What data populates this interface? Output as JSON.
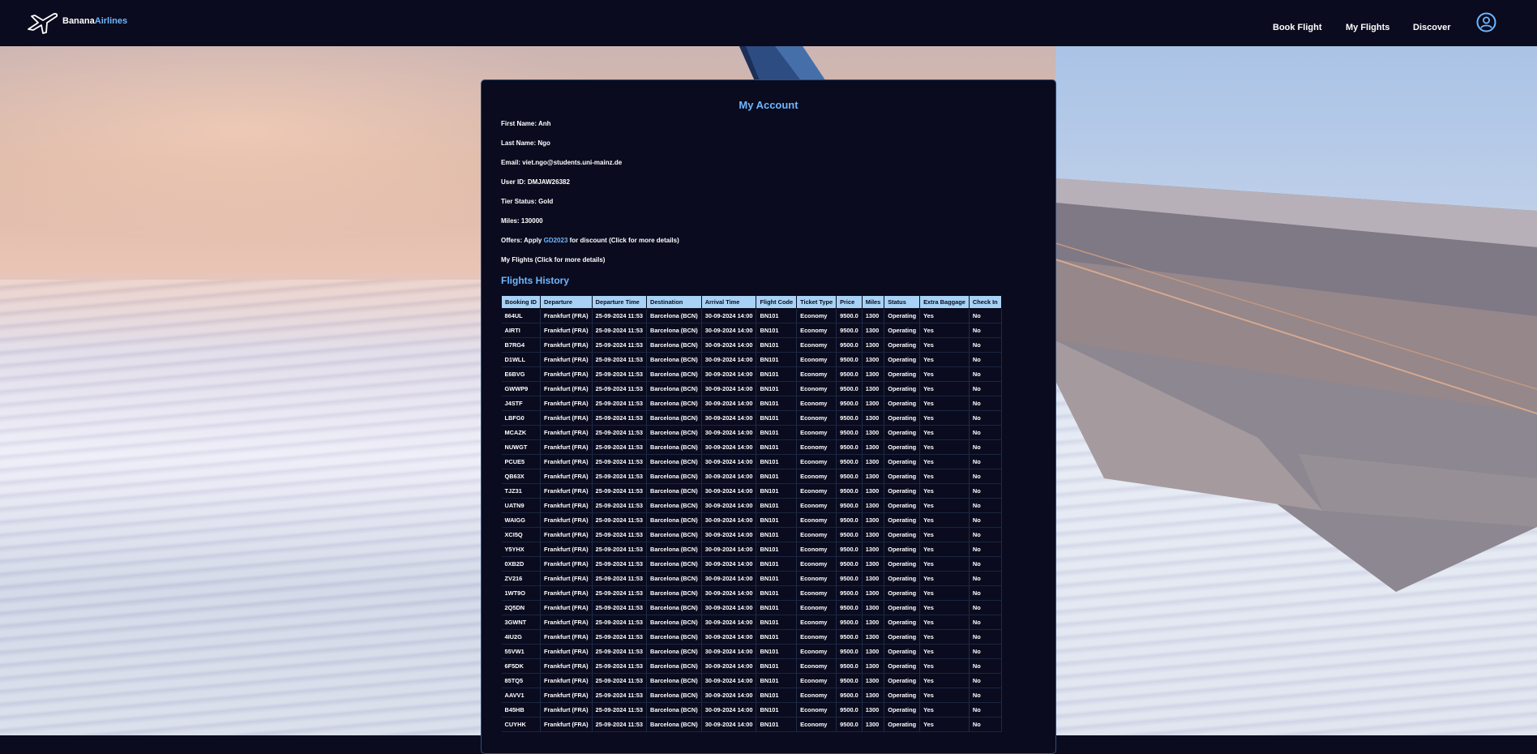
{
  "brand": {
    "name_part1": "Banana",
    "name_part2": "Airlines"
  },
  "nav": {
    "book_flight": "Book Flight",
    "my_flights": "My Flights",
    "discover": "Discover"
  },
  "account": {
    "title": "My Account",
    "first_name": "First Name: Anh",
    "last_name": "Last Name: Ngo",
    "email": "Email: viet.ngo@students.uni-mainz.de",
    "user_id": "User ID: DMJAW26382",
    "tier_status": "Tier Status: Gold",
    "miles": "Miles: 130000",
    "offers_prefix": "Offers: Apply ",
    "offers_code": "GD2023",
    "offers_suffix": " for discount (Click for more details)",
    "my_flights_link": "My Flights (Click for more details)"
  },
  "history": {
    "title": "Flights History",
    "columns": [
      "Booking ID",
      "Departure",
      "Departure Time",
      "Destination",
      "Arrival Time",
      "Flight Code",
      "Ticket Type",
      "Price",
      "Miles",
      "Status",
      "Extra Baggage",
      "Check In"
    ],
    "common": {
      "departure": "Frankfurt (FRA)",
      "departure_time": "25-09-2024 11:53",
      "destination": "Barcelona (BCN)",
      "arrival_time": "30-09-2024 14:00",
      "flight_code": "BN101",
      "ticket_type": "Economy",
      "price": "9500.0",
      "miles": "1300",
      "status": "Operating",
      "extra_baggage": "Yes",
      "check_in": "No"
    },
    "booking_ids": [
      "864UL",
      "AIRTI",
      "B7RG4",
      "D1WLL",
      "E6BVG",
      "GWWP9",
      "J4STF",
      "LBFG0",
      "MCAZK",
      "NUWGT",
      "PCUE5",
      "QB63X",
      "TJZ31",
      "UATN9",
      "WAIGG",
      "XCI5Q",
      "Y5YHX",
      "0XB2D",
      "ZV216",
      "1WT9O",
      "2Q5DN",
      "3GWNT",
      "4IU2G",
      "55VW1",
      "6F5DK",
      "85TQ5",
      "AAVV1",
      "B45HB",
      "CUYHK"
    ]
  },
  "colors": {
    "navbar": "#0a0b1e",
    "accent": "#6fb6ff",
    "table_header": "#a7d2f5"
  },
  "icons": {
    "logo": "airplane-icon",
    "profile": "user-circle-icon"
  }
}
